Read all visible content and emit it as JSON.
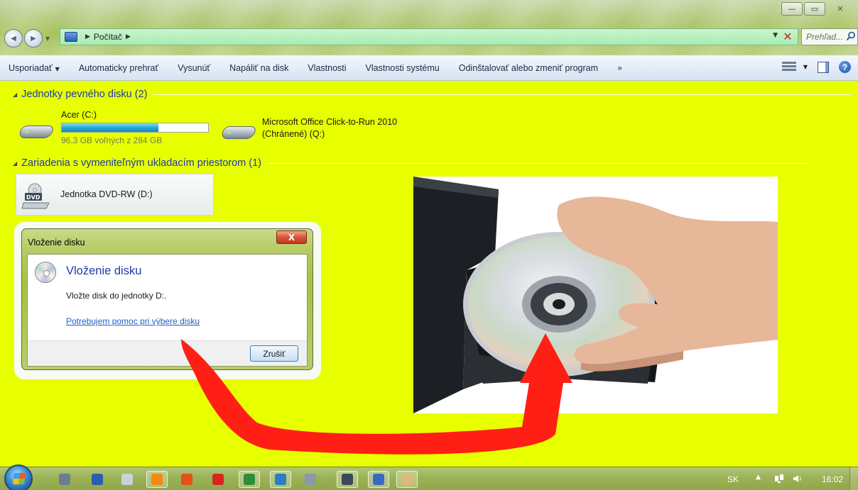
{
  "window": {
    "minimize_glyph": "—",
    "maximize_glyph": "▭",
    "close_glyph": "✕"
  },
  "nav": {
    "back_glyph": "◀",
    "forward_glyph": "▶",
    "dropdown_glyph": "▼"
  },
  "address": {
    "crumb": "Počítač",
    "arrow_glyph": "▶",
    "dropdown_glyph": "▼",
    "clear_glyph": "✕"
  },
  "search": {
    "placeholder": "Prehľad..."
  },
  "toolbar": {
    "items": [
      {
        "label": "Usporiadať",
        "has_caret": true
      },
      {
        "label": "Automaticky prehrať"
      },
      {
        "label": "Vysunúť"
      },
      {
        "label": "Napáliť na disk"
      },
      {
        "label": "Vlastnosti"
      },
      {
        "label": "Vlastnosti systému"
      },
      {
        "label": "Odinštalovať alebo zmeniť program"
      }
    ],
    "more_glyph": "»",
    "caret_glyph": "▼",
    "help_glyph": "?"
  },
  "sections": {
    "hard_disks": {
      "title": "Jednotky pevného disku (2)",
      "toggle_glyph": "◢"
    },
    "removable": {
      "title": "Zariadenia s vymeniteľným ukladacím priestorom (1)",
      "toggle_glyph": "◢"
    }
  },
  "drives": {
    "acer": {
      "name": "Acer (C:)",
      "free_text": "96,3 GB voľných z 284 GB",
      "used_fraction": 0.66
    },
    "office": {
      "name_line1": "Microsoft Office Click-to-Run 2010",
      "name_line2": "(Chránené) (Q:)"
    },
    "dvd": {
      "name": "Jednotka DVD-RW (D:)",
      "icon_text": "DVD"
    }
  },
  "dialog": {
    "title": "Vloženie disku",
    "close_glyph": "X",
    "heading": "Vloženie disku",
    "message": "Vložte disk do jednotky D:.",
    "help_link": "Potrebujem pomoc pri výbere disku",
    "cancel_label": "Zrušiť"
  },
  "taskbar": {
    "language": "SK",
    "tray_arrow_glyph": "▲",
    "clock": "16:02",
    "apps": [
      {
        "name": "tool-icon",
        "color": "#6b7d95"
      },
      {
        "name": "pen-icon",
        "color": "#2b5fa8"
      },
      {
        "name": "document-icon",
        "color": "#c9d2dc"
      },
      {
        "name": "vlc-icon",
        "color": "#f08a12"
      },
      {
        "name": "firefox-icon",
        "color": "#e0531a"
      },
      {
        "name": "acrobat-icon",
        "color": "#d8261f"
      },
      {
        "name": "chrome-icon",
        "color": "#2f8d3a"
      },
      {
        "name": "paint-icon",
        "color": "#2a7fc0"
      },
      {
        "name": "feather-icon",
        "color": "#8899aa"
      },
      {
        "name": "camera-icon",
        "color": "#3a4a5a"
      },
      {
        "name": "control-panel-icon",
        "color": "#3a6ac0"
      },
      {
        "name": "picture-icon",
        "color": "#dcb97a"
      }
    ]
  }
}
